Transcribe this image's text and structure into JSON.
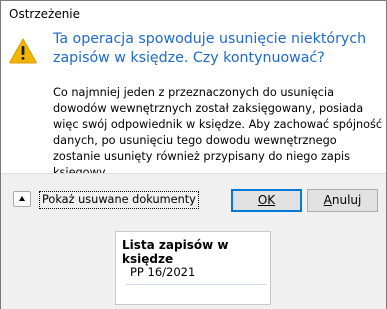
{
  "window": {
    "title": "Ostrzeżenie"
  },
  "message": {
    "main_instruction": "Ta operacja spowoduje usunięcie niektórych zapisów w księdze. Czy kontynuować?",
    "content": "Co najmniej jeden z przeznaczonych do usunięcia dowodów wewnętrznych został zaksięgowany, posiada więc swój odpowiednik w księdze. Aby zachować spójność danych, po usunięciu tego dowodu wewnętrznego zostanie usunięty również przypisany do niego zapis księgowy.",
    "icon": "warning-icon"
  },
  "footer": {
    "expander_label": "Pokaż usuwane dokumenty",
    "ok_label": "OK",
    "cancel_label_underlined": "A",
    "cancel_label_rest": "nuluj"
  },
  "panel": {
    "title": "Lista zapisów w księdze",
    "items": [
      "PP 16/2021"
    ]
  },
  "colors": {
    "instruction": "#1e6ac8",
    "footer_bg": "#f0f0f0",
    "default_button_border": "#0078d7"
  }
}
